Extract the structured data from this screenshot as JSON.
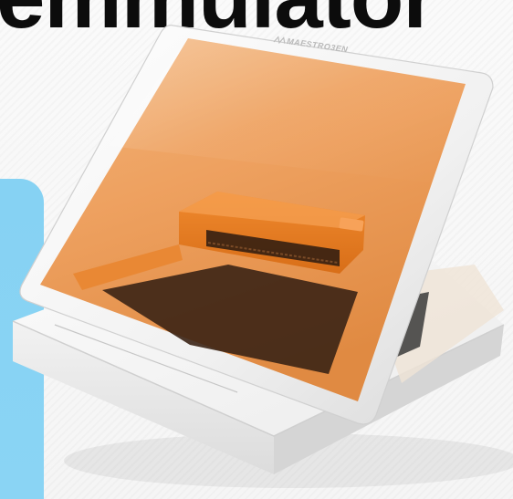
{
  "headline": "emmulator",
  "brand": {
    "logo_text": "MAESTRO3EN"
  },
  "colors": {
    "accent_blue": "#89d3f3",
    "amber_screen": "#f0a868",
    "device_white": "#f6f6f6",
    "headline_black": "#0c0c0c"
  },
  "scene": {
    "subject": "printer-device-with-amber-lid"
  }
}
